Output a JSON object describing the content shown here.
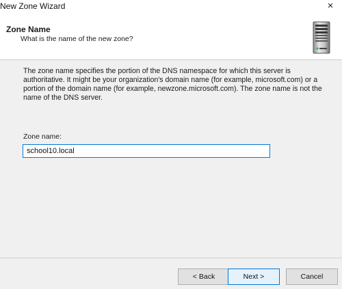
{
  "window": {
    "title": "New Zone Wizard",
    "close_glyph": "×"
  },
  "header": {
    "heading": "Zone Name",
    "subheading": "What is the name of the new zone?",
    "icon": "server-icon"
  },
  "main": {
    "description": "The zone name specifies the portion of the DNS namespace for which this server is authoritative. It might be your organization's domain name (for example,  microsoft.com) or a portion of the domain name (for example, newzone.microsoft.com). The zone name is not the name of the DNS server.",
    "zone_name_label": "Zone name:",
    "zone_name_value": "school10.local"
  },
  "footer": {
    "back_label": "< Back",
    "next_label": "Next >",
    "cancel_label": "Cancel"
  },
  "colors": {
    "accent": "#0078d7",
    "panel": "#f0f0f0"
  }
}
